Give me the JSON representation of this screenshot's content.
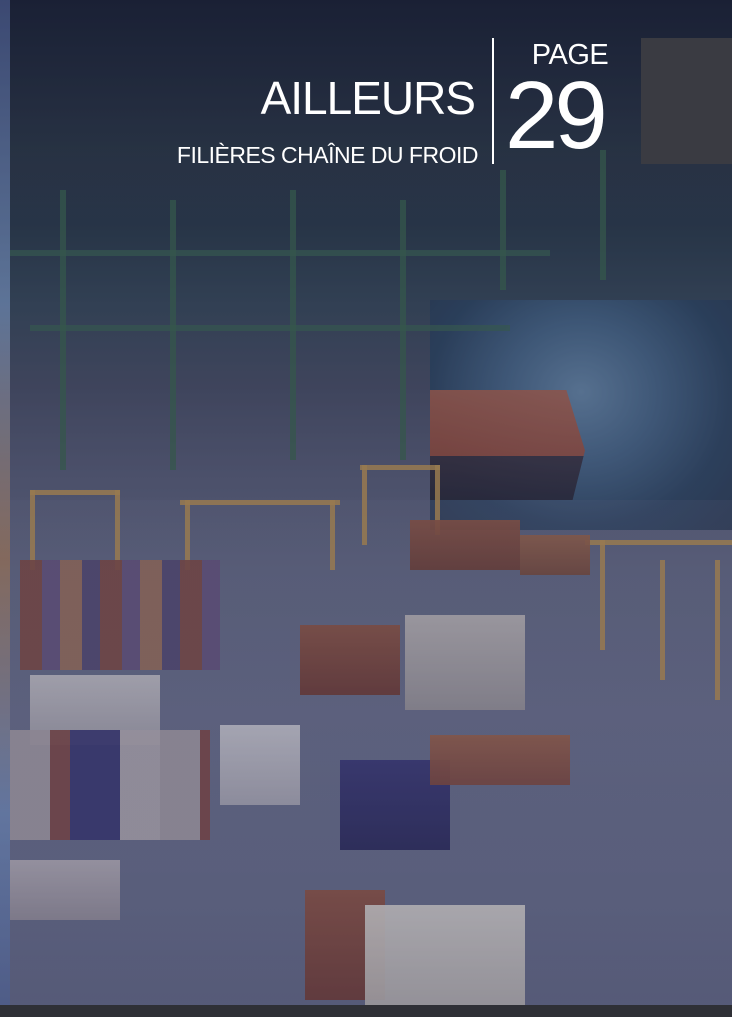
{
  "header": {
    "title": "AILLEURS",
    "subtitle": "FILIÈRES CHAÎNE DU FROID",
    "page_label": "PAGE",
    "page_number": "29"
  }
}
